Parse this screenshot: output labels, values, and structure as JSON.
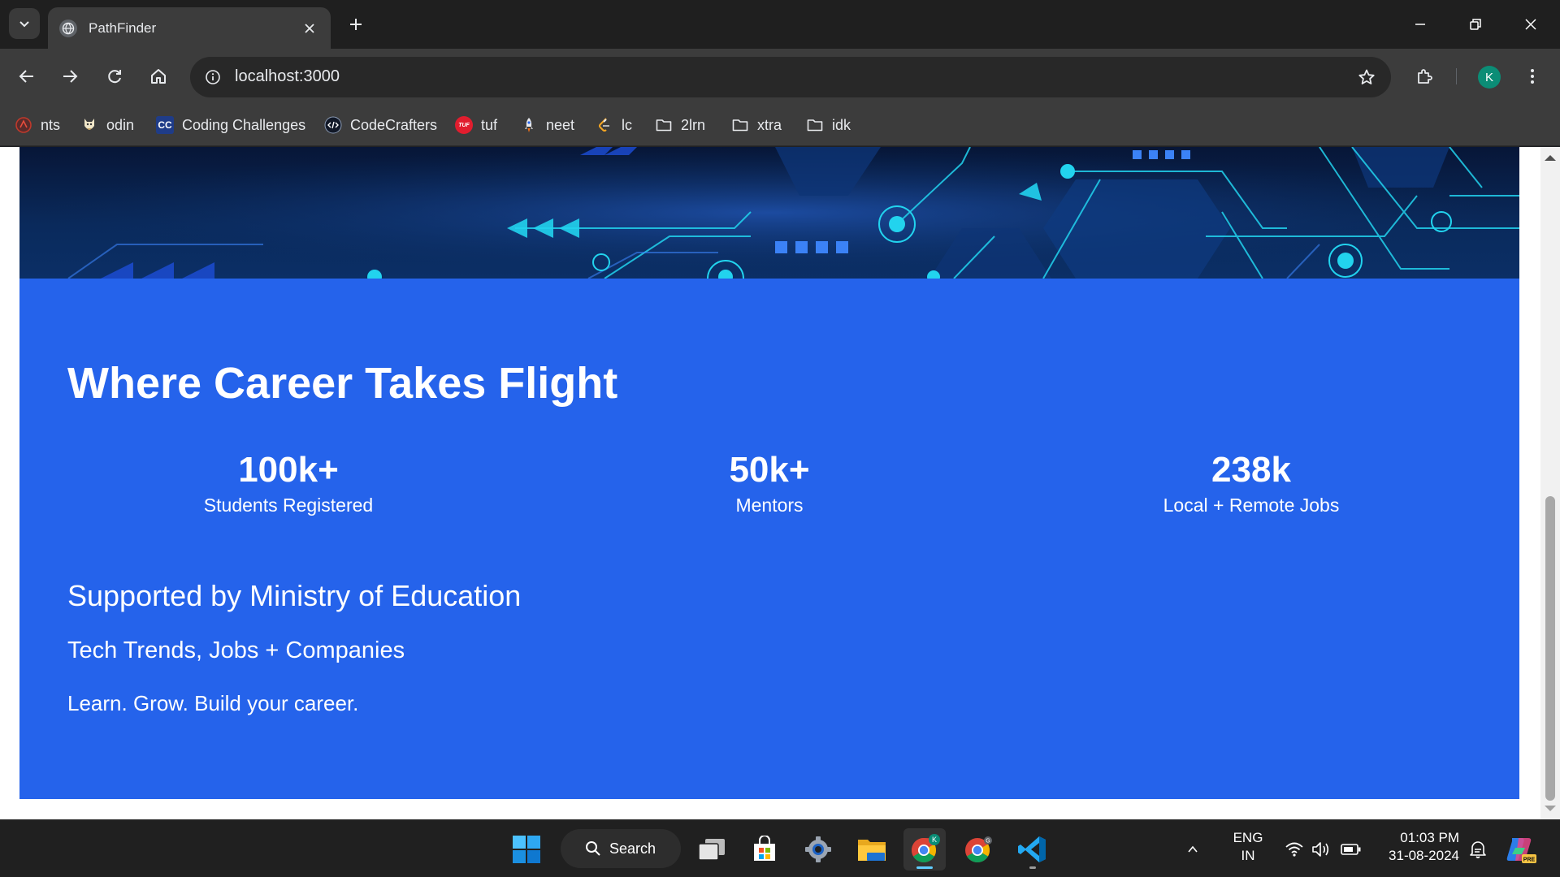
{
  "browser": {
    "tab_title": "PathFinder",
    "url": "localhost:3000",
    "profile_initial": "K",
    "bookmarks": [
      {
        "label": "nts",
        "icon": "nts-favicon-icon"
      },
      {
        "label": "odin",
        "icon": "odin-favicon-icon"
      },
      {
        "label": "Coding Challenges",
        "icon": "cc-favicon-icon"
      },
      {
        "label": "CodeCrafters",
        "icon": "codecrafters-favicon-icon"
      },
      {
        "label": "tuf",
        "icon": "tuf-favicon-icon"
      },
      {
        "label": "neet",
        "icon": "rocket-icon"
      },
      {
        "label": "lc",
        "icon": "leetcode-icon"
      },
      {
        "label": "2lrn",
        "icon": "folder-icon"
      },
      {
        "label": "xtra",
        "icon": "folder-icon"
      },
      {
        "label": "idk",
        "icon": "folder-icon"
      }
    ],
    "cc_icon_text": "CC",
    "tuf_icon_text": "TUF"
  },
  "page": {
    "headline": "Where Career Takes Flight",
    "stats": [
      {
        "value": "100k+",
        "label": "Students Registered"
      },
      {
        "value": "50k+",
        "label": "Mentors"
      },
      {
        "value": "238k",
        "label": "Local + Remote Jobs"
      }
    ],
    "supported": "Supported by Ministry of Education",
    "tagline": "Tech Trends, Jobs + Companies",
    "motto": "Learn. Grow. Build your career.",
    "colors": {
      "section_bg": "#2563eb",
      "circuit_accent": "#22d3ee"
    }
  },
  "taskbar": {
    "search_label": "Search",
    "lang_line1": "ENG",
    "lang_line2": "IN",
    "time": "01:03 PM",
    "date": "31-08-2024",
    "chrome_badge": "K",
    "chrome2_badge": "G",
    "copilot_badge": "PRE"
  }
}
